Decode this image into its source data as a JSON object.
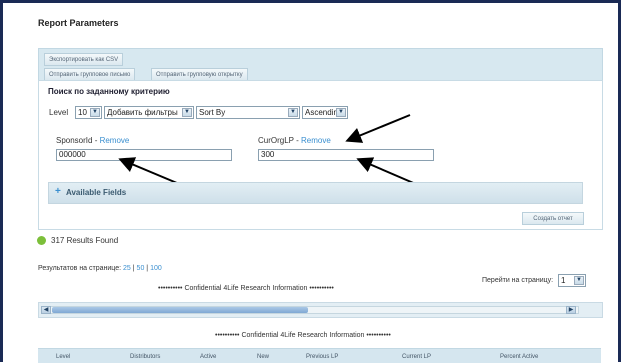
{
  "page": {
    "title": "Report Parameters"
  },
  "toolbar": {
    "export_csv": "Экспортировать как CSV",
    "send_bulk_email": "Отправить групповое письмо",
    "send_bulk_card": "Отправить групповую открытку"
  },
  "search": {
    "title": "Поиск по заданному критерию",
    "level_label": "Level",
    "level_value": "10",
    "add_filters": "Добавить фильтры",
    "sort_by": "Sort By",
    "sort_order": "Ascending",
    "fields": [
      {
        "label": "SponsorId",
        "remove": "Remove",
        "value": "000000"
      },
      {
        "label": "CurOrgLP",
        "remove": "Remove",
        "value": "300"
      }
    ],
    "separator": " - ",
    "available_fields": "Available Fields",
    "create_report": "Создать отчет"
  },
  "results": {
    "count_text": "317 Results Found",
    "per_page_label": "Результатов на странице:",
    "per_page_options": [
      "25",
      "50",
      "100"
    ],
    "pipe": "|",
    "goto_label": "Перейти на страницу:",
    "goto_value": "1",
    "confidential": "•••••••••• Confidential 4Life Research Information ••••••••••"
  },
  "table": {
    "headers": [
      "Level",
      "Distributors",
      "Active",
      "New",
      "Previous LP",
      "Current LP",
      "Percent Active"
    ]
  },
  "icons": {
    "ok": "check-circle-icon",
    "plus": "plus-icon",
    "dropdown": "chevron-down-icon",
    "scroll_left": "arrow-left-icon",
    "scroll_right": "arrow-right-icon"
  },
  "colors": {
    "accent": "#3a8fd0",
    "panel": "#d7e8f0",
    "ok": "#7cbf3a",
    "frame": "#1a2a55"
  }
}
